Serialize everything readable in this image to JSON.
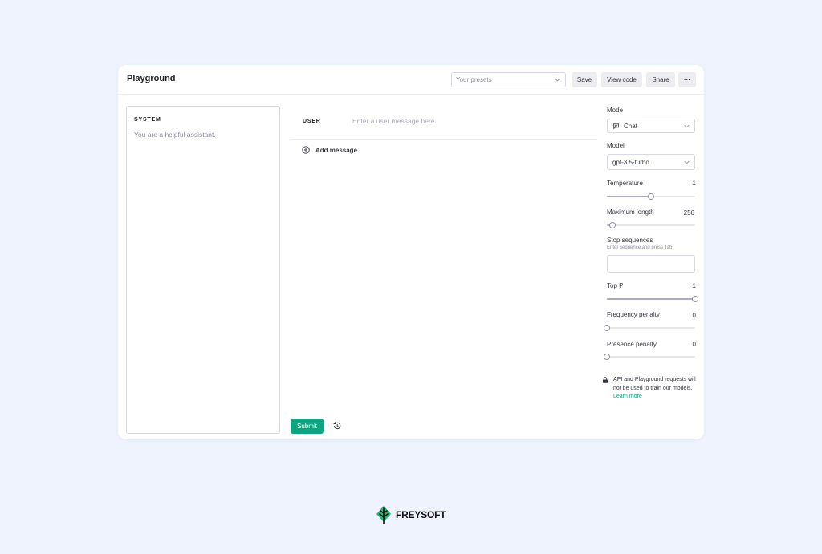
{
  "header": {
    "title": "Playground",
    "presets_placeholder": "Your presets",
    "save_label": "Save",
    "view_code_label": "View code",
    "share_label": "Share",
    "more_label": "···"
  },
  "system": {
    "label": "SYSTEM",
    "placeholder": "You are a helpful assistant."
  },
  "chat": {
    "user_label": "USER",
    "user_placeholder": "Enter a user message here.",
    "add_message_label": "Add message",
    "submit_label": "Submit"
  },
  "settings": {
    "mode_label": "Mode",
    "mode_value": "Chat",
    "model_label": "Model",
    "model_value": "gpt-3.5-turbo",
    "temperature": {
      "label": "Temperature",
      "value": "1",
      "fraction": 0.5
    },
    "max_length": {
      "label": "Maximum length",
      "value": "256",
      "fraction": 0.06
    },
    "stop_sequences": {
      "label": "Stop sequences",
      "hint": "Enter sequence and press Tab"
    },
    "top_p": {
      "label": "Top P",
      "value": "1",
      "fraction": 1.0
    },
    "frequency_penalty": {
      "label": "Frequency penalty",
      "value": "0",
      "fraction": 0.0
    },
    "presence_penalty": {
      "label": "Presence penalty",
      "value": "0",
      "fraction": 0.0
    }
  },
  "notice": {
    "text": "API and Playground requests will not be used to train our models.",
    "link": "Learn more"
  },
  "brand": {
    "name": "FREYSOFT",
    "accent": "#10a37f",
    "logo_color": "#2bb673"
  },
  "icons": [
    "chevron-down-icon",
    "chat-bubble-icon",
    "plus-circle-icon",
    "history-icon",
    "lock-icon",
    "tree-logo-icon"
  ]
}
